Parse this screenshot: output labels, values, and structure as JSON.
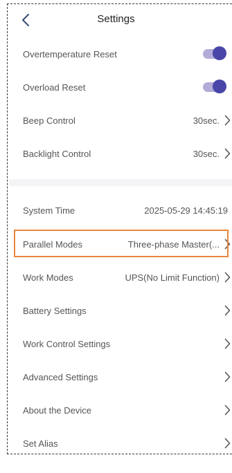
{
  "header": {
    "title": "Settings",
    "back_icon": "chevron-left-icon"
  },
  "section1": [
    {
      "label": "Overtemperature Reset",
      "toggle": true
    },
    {
      "label": "Overload Reset",
      "toggle": true
    },
    {
      "label": "Beep Control",
      "value": "30sec."
    },
    {
      "label": "Backlight Control",
      "value": "30sec."
    }
  ],
  "section2": [
    {
      "label": "System Time",
      "value": "2025-05-29 14:45:19"
    },
    {
      "label": "Parallel Modes",
      "value": "Three-phase Master(..."
    },
    {
      "label": "Work Modes",
      "value": "UPS(No Limit Function)"
    },
    {
      "label": "Battery Settings"
    },
    {
      "label": "Work Control Settings"
    },
    {
      "label": "Advanced Settings"
    },
    {
      "label": "About the Device"
    },
    {
      "label": "Set Alias"
    }
  ],
  "colors": {
    "toggle_on": "#4a46a8",
    "toggle_track": "#b3acd8",
    "highlight": "#e8853d",
    "divider": "#f4f4f6"
  }
}
